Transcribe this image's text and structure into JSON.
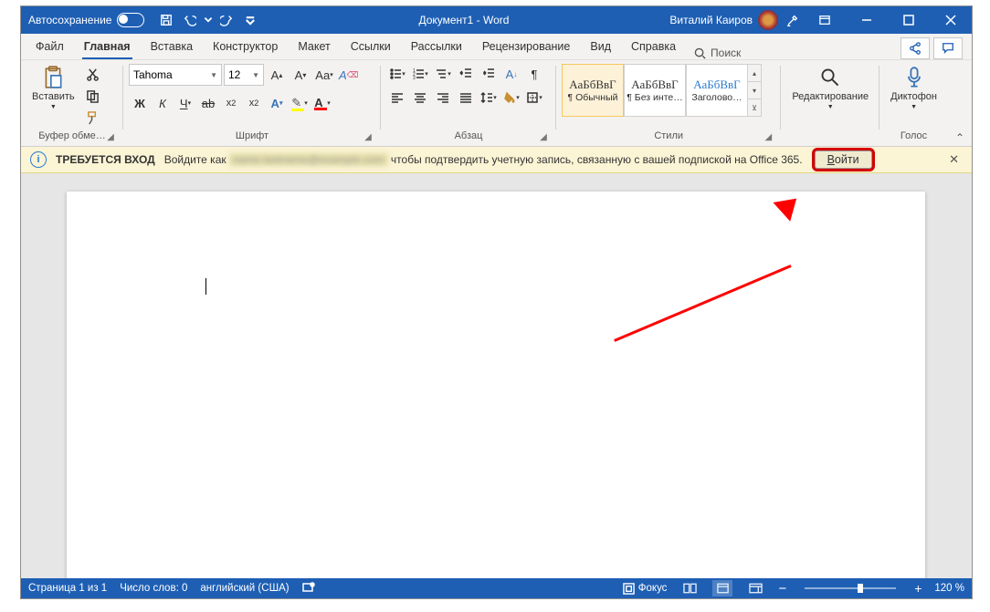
{
  "titlebar": {
    "autosave": "Автосохранение",
    "doc_title": "Документ1 - Word",
    "user": "Виталий Каиров"
  },
  "tabs": {
    "file": "Файл",
    "home": "Главная",
    "insert": "Вставка",
    "design": "Конструктор",
    "layout": "Макет",
    "references": "Ссылки",
    "mailings": "Рассылки",
    "review": "Рецензирование",
    "view": "Вид",
    "help": "Справка",
    "search": "Поиск"
  },
  "ribbon": {
    "clipboard": {
      "label": "Буфер обме…",
      "paste": "Вставить"
    },
    "font": {
      "label": "Шрифт",
      "family": "Tahoma",
      "size": "12"
    },
    "paragraph": {
      "label": "Абзац"
    },
    "styles": {
      "label": "Стили",
      "preview": "АаБбВвГ",
      "normal": "¶ Обычный",
      "nospace": "¶ Без инте…",
      "heading": "Заголово…"
    },
    "editing": {
      "label": "Редактирование"
    },
    "voice": {
      "label": "Голос",
      "dictate": "Диктофон"
    }
  },
  "infobar": {
    "heading": "ТРЕБУЕТСЯ ВХОД",
    "pre": "Войдите как",
    "blur": "name.lastname@example.com",
    "post": "чтобы подтвердить учетную запись, связанную с вашей подпиской на Office 365.",
    "button_letter": "В",
    "button_rest": "ойти"
  },
  "status": {
    "page": "Страница 1 из 1",
    "words": "Число слов: 0",
    "lang": "английский (США)",
    "focus": "Фокус",
    "zoom": "120 %"
  }
}
